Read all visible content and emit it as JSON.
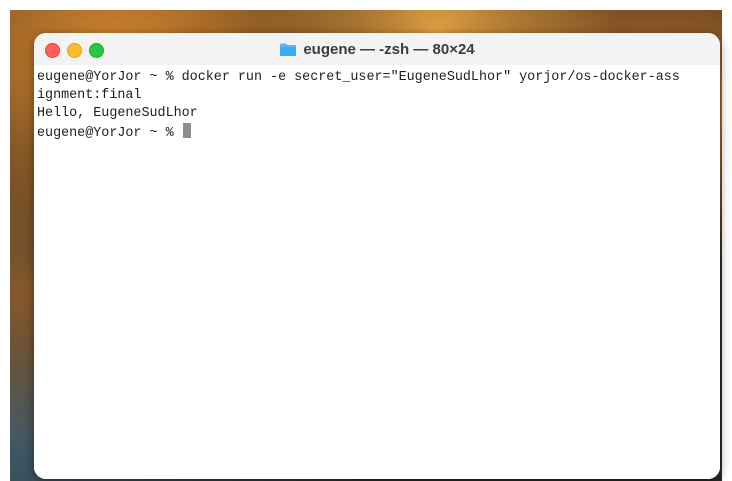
{
  "window": {
    "title": "eugene — -zsh — 80×24",
    "folder_icon": "folder-icon"
  },
  "terminal": {
    "lines": [
      "eugene@YorJor ~ % docker run -e secret_user=\"EugeneSudLhor\" yorjor/os-docker-ass",
      "ignment:final",
      "Hello, EugeneSudLhor",
      "eugene@YorJor ~ % "
    ]
  },
  "colors": {
    "close": "#ff5f57",
    "minimize": "#febc2e",
    "zoom": "#28c840",
    "folder": "#3fa9f5"
  }
}
